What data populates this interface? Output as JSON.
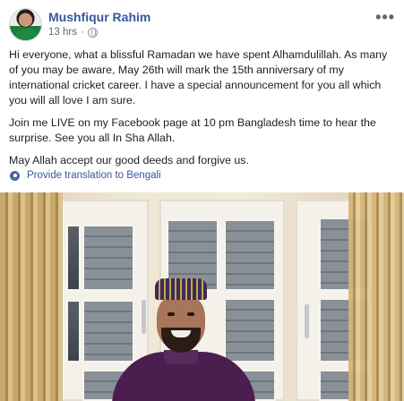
{
  "post": {
    "author": "Mushfiqur Rahim",
    "time": "13 hrs",
    "dot": "·",
    "more_label": "•••",
    "paragraphs": [
      "Hi everyone, what a blissful Ramadan we have spent Alhamdulillah. As many of you may be aware, May 26th will mark the 15th anniversary of my international cricket career. I have a special announcement for you all which you will all love I am sure.",
      "Join me LIVE on my Facebook page at 10 pm Bangladesh time to hear the surprise. See you all In Sha Allah.",
      "May Allah accept our good deeds and forgive us."
    ],
    "translate_label": "Provide translation to Bengali"
  },
  "icons": {
    "globe": "globe-icon",
    "settings": "gear-icon",
    "more": "more-options-icon"
  },
  "colors": {
    "link": "#385898",
    "text": "#1c1e21",
    "meta": "#616770"
  }
}
